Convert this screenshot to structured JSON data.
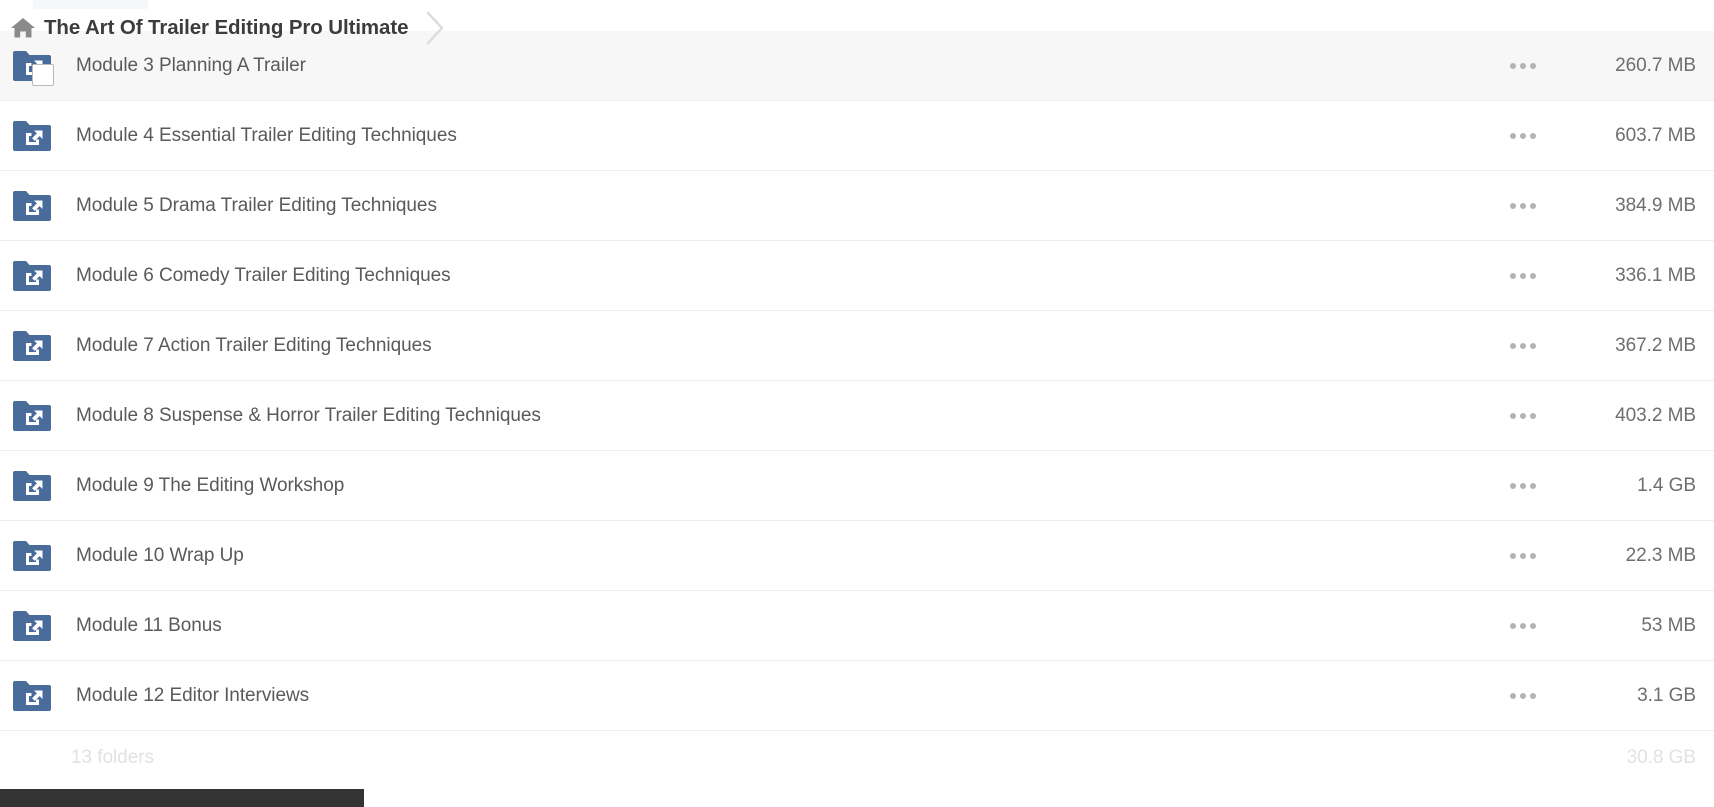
{
  "breadcrumb": {
    "home_icon": "home-icon",
    "title": "The Art Of Trailer Editing Pro Ultimate",
    "separator_icon": "chevron-right-icon"
  },
  "colors": {
    "folder_blue": "#4a6c9b",
    "row_highlight": "#f7f7f7",
    "row_border": "#eeeeee",
    "name_text": "#5a5a5a",
    "size_text": "#6e6e6e",
    "footer_text": "#e2e2e2",
    "dots": "#b3b3b3",
    "scrollbar_thumb": "#333333",
    "title_text": "#3c3c3c"
  },
  "list": {
    "menu_icon": "more-options-icon",
    "folder_icon": "shared-folder-icon",
    "rows": [
      {
        "name": "Module 3 Planning A Trailer",
        "size": "260.7 MB",
        "highlight": true,
        "dragging": true
      },
      {
        "name": "Module 4 Essential Trailer Editing Techniques",
        "size": "603.7 MB",
        "highlight": false,
        "dragging": false
      },
      {
        "name": "Module 5 Drama Trailer Editing Techniques",
        "size": "384.9 MB",
        "highlight": false,
        "dragging": false
      },
      {
        "name": "Module 6 Comedy Trailer Editing Techniques",
        "size": "336.1 MB",
        "highlight": false,
        "dragging": false
      },
      {
        "name": "Module 7 Action Trailer Editing Techniques",
        "size": "367.2 MB",
        "highlight": false,
        "dragging": false
      },
      {
        "name": "Module 8 Suspense & Horror Trailer Editing Techniques",
        "size": "403.2 MB",
        "highlight": false,
        "dragging": false
      },
      {
        "name": "Module 9 The Editing Workshop",
        "size": "1.4 GB",
        "highlight": false,
        "dragging": false
      },
      {
        "name": "Module 10 Wrap Up",
        "size": "22.3 MB",
        "highlight": false,
        "dragging": false
      },
      {
        "name": "Module 11 Bonus",
        "size": "53 MB",
        "highlight": false,
        "dragging": false
      },
      {
        "name": "Module 12 Editor Interviews",
        "size": "3.1 GB",
        "highlight": false,
        "dragging": false
      }
    ]
  },
  "footer": {
    "count": "13 folders",
    "total_size": "30.8 GB"
  },
  "scrollbar": {
    "orientation": "horizontal"
  }
}
